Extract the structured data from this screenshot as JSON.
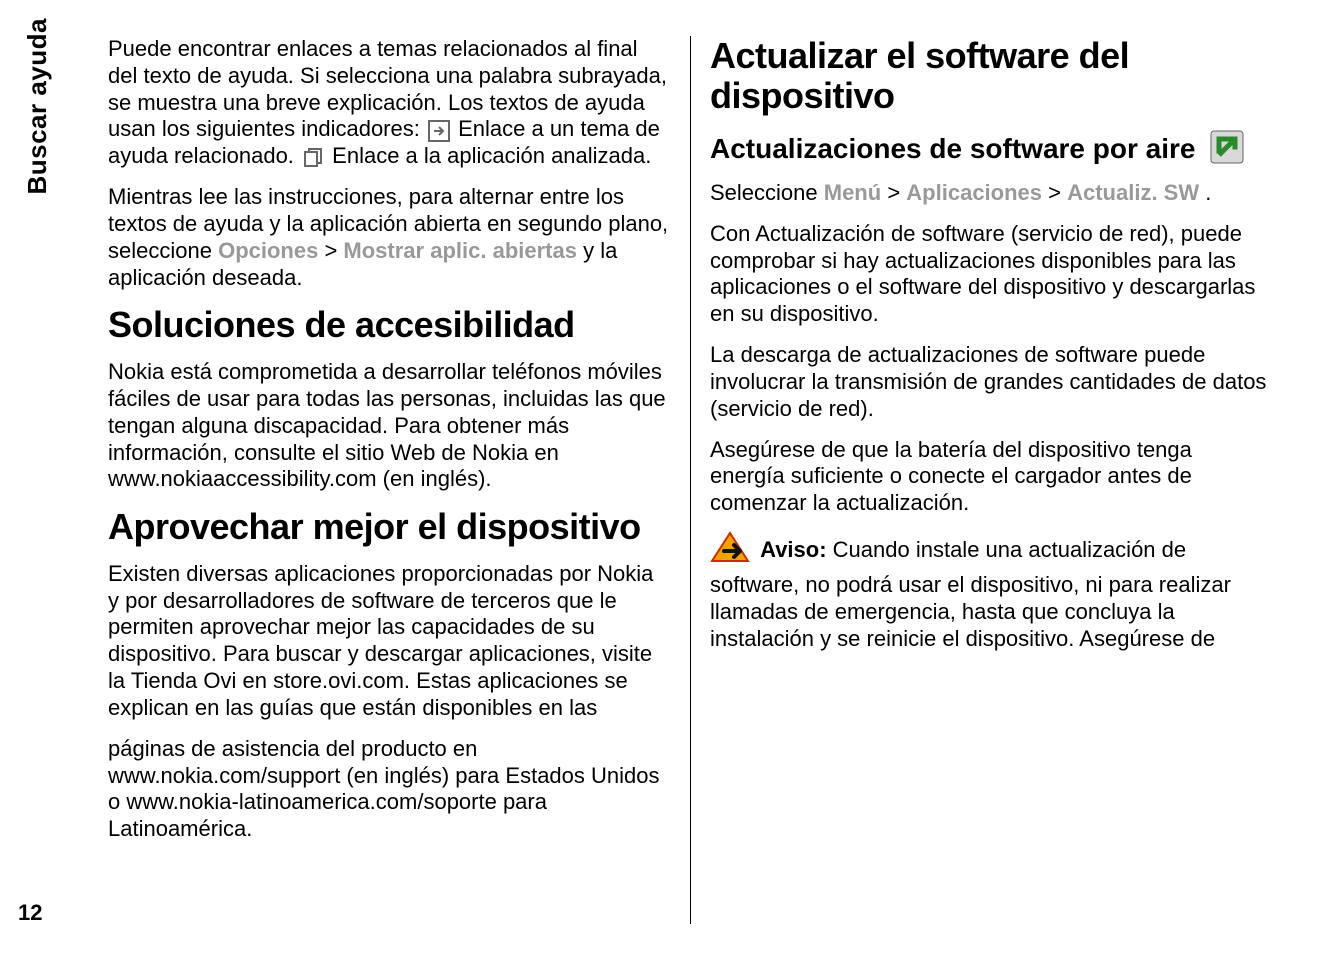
{
  "sideTab": "Buscar ayuda",
  "pageNumber": "12",
  "p1a": "Puede encontrar enlaces a temas relacionados al final del texto de ayuda. Si selecciona una palabra subrayada, se muestra una breve explicación. Los textos de ayuda usan los siguientes indicadores: ",
  "p1b": " Enlace a un tema de ayuda relacionado. ",
  "p1c": " Enlace a la aplicación analizada.",
  "p2a": "Mientras lee las instrucciones, para alternar entre los textos de ayuda y la aplicación abierta en segundo plano, seleccione ",
  "p2_opt": "Opciones",
  "p2_sep": " > ",
  "p2_mostrar": "Mostrar aplic. abiertas",
  "p2b": " y la aplicación deseada.",
  "h1_soluciones": "Soluciones de accesibilidad",
  "p3": "Nokia está comprometida a desarrollar teléfonos móviles fáciles de usar para todas las personas, incluidas las que tengan alguna discapacidad. Para obtener más información, consulte el sitio Web de Nokia en www.nokiaaccessibility.com (en inglés).",
  "h1_aprovechar": "Aprovechar mejor el dispositivo",
  "p4": "Existen diversas aplicaciones proporcionadas por Nokia y por desarrolladores de software de terceros que le permiten aprovechar mejor las capacidades de su dispositivo. Para buscar y descargar aplicaciones, visite la Tienda Ovi en store.ovi.com. Estas aplicaciones se explican en las guías que están disponibles en las",
  "p5": "páginas de asistencia del producto en www.nokia.com/support (en inglés) para Estados Unidos o www.nokia-latinoamerica.com/soporte para Latinoamérica.",
  "h1_actualizar": "Actualizar el software del dispositivo",
  "h2_aire": "Actualizaciones de software por aire",
  "p6a": "Seleccione ",
  "p6_menu": "Menú",
  "p6_sep1": " > ",
  "p6_apps": "Aplicaciones",
  "p6_sep2": " > ",
  "p6_sw": "Actualiz. SW",
  "p6b": ".",
  "p7": "Con Actualización de software (servicio de red), puede comprobar si hay actualizaciones disponibles para las aplicaciones o el software del dispositivo y descargarlas en su dispositivo.",
  "p8": "La descarga de actualizaciones de software puede involucrar la transmisión de grandes cantidades de datos (servicio de red).",
  "p9": "Asegúrese de que la batería del dispositivo tenga energía suficiente o conecte el cargador antes de comenzar la actualización.",
  "p10_aviso": "Aviso: ",
  "p10": " Cuando instale una actualización de software, no podrá usar el dispositivo, ni para realizar llamadas de emergencia, hasta que concluya la instalación y se reinicie el dispositivo. Asegúrese de"
}
